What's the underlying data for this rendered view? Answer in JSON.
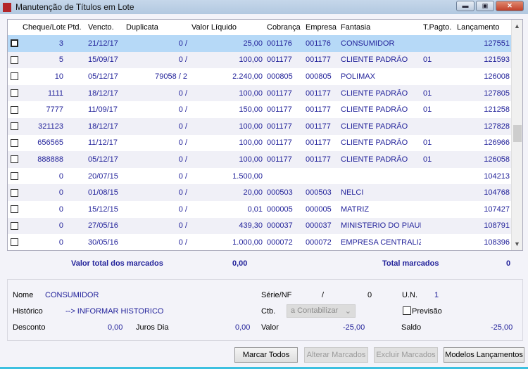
{
  "window": {
    "title": "Manutenção de Títulos em Lote",
    "logo_text": "M",
    "controls": [
      "minimize-icon",
      "maximize-icon",
      "close-icon"
    ]
  },
  "grid": {
    "columns": [
      "",
      "Cheque/Lote",
      "Ptd.",
      "Vencto.",
      "Duplicata",
      "Valor Líquido",
      "Cobrança",
      "Empresa",
      "Fantasia",
      "T.Pagto.",
      "Lançamento"
    ],
    "rows": [
      [
        "3",
        "",
        "21/12/17",
        "0 /",
        "25,00",
        "001176",
        "001176",
        "CONSUMIDOR",
        "",
        "127551"
      ],
      [
        "5",
        "",
        "15/09/17",
        "0 /",
        "100,00",
        "001177",
        "001177",
        "CLIENTE PADRÃO",
        "01",
        "121593"
      ],
      [
        "10",
        "",
        "05/12/17",
        "79058 / 2",
        "2.240,00",
        "000805",
        "000805",
        "POLIMAX",
        "",
        "126008"
      ],
      [
        "1111",
        "",
        "18/12/17",
        "0 /",
        "100,00",
        "001177",
        "001177",
        "CLIENTE PADRÃO",
        "01",
        "127805"
      ],
      [
        "7777",
        "",
        "11/09/17",
        "0 /",
        "150,00",
        "001177",
        "001177",
        "CLIENTE PADRÃO",
        "01",
        "121258"
      ],
      [
        "321123",
        "",
        "18/12/17",
        "0 /",
        "100,00",
        "001177",
        "001177",
        "CLIENTE PADRÃO",
        "",
        "127828"
      ],
      [
        "656565",
        "",
        "11/12/17",
        "0 /",
        "100,00",
        "001177",
        "001177",
        "CLIENTE PADRÃO",
        "01",
        "126966"
      ],
      [
        "888888",
        "",
        "05/12/17",
        "0 /",
        "100,00",
        "001177",
        "001177",
        "CLIENTE PADRÃO",
        "01",
        "126058"
      ],
      [
        "0",
        "",
        "20/07/15",
        "0 /",
        "1.500,00",
        "",
        "",
        "",
        "",
        "104213"
      ],
      [
        "0",
        "",
        "01/08/15",
        "0 /",
        "20,00",
        "000503",
        "000503",
        "NELCI",
        "",
        "104768"
      ],
      [
        "0",
        "",
        "15/12/15",
        "0 /",
        "0,01",
        "000005",
        "000005",
        "MATRIZ",
        "",
        "107427"
      ],
      [
        "0",
        "",
        "27/05/16",
        "0 /",
        "439,30",
        "000037",
        "000037",
        "MINISTERIO DO PIAUI",
        "",
        "108791"
      ],
      [
        "0",
        "",
        "30/05/16",
        "0 /",
        "1.000,00",
        "000072",
        "000072",
        "EMPRESA CENTRALIZADORA",
        "",
        "108396"
      ]
    ],
    "selected_row": 0
  },
  "totals": {
    "valor_label": "Valor total dos marcados",
    "valor": "0,00",
    "total_label": "Total marcados",
    "total": "0"
  },
  "details": {
    "nome_label": "Nome",
    "nome": "CONSUMIDOR",
    "serie_label": "Série/NF",
    "serie_sep": "/",
    "serie_value": "0",
    "un_label": "U.N.",
    "un_value": "1",
    "historico_label": "Histórico",
    "historico": "--> INFORMAR HISTORICO",
    "ctb_label": "Ctb.",
    "ctb_value": "a Contabilizar",
    "previsao_label": "Previsão",
    "previsao_checked": false,
    "desconto_label": "Desconto",
    "desconto": "0,00",
    "juros_label": "Juros Dia",
    "juros": "0,00",
    "valor_label": "Valor",
    "valor": "-25,00",
    "saldo_label": "Saldo",
    "saldo": "-25,00"
  },
  "buttons": {
    "marcar": "Marcar Todos",
    "alterar": "Alterar Marcados",
    "excluir": "Excluir Marcados",
    "modelos": "Modelos Lançamentos"
  }
}
